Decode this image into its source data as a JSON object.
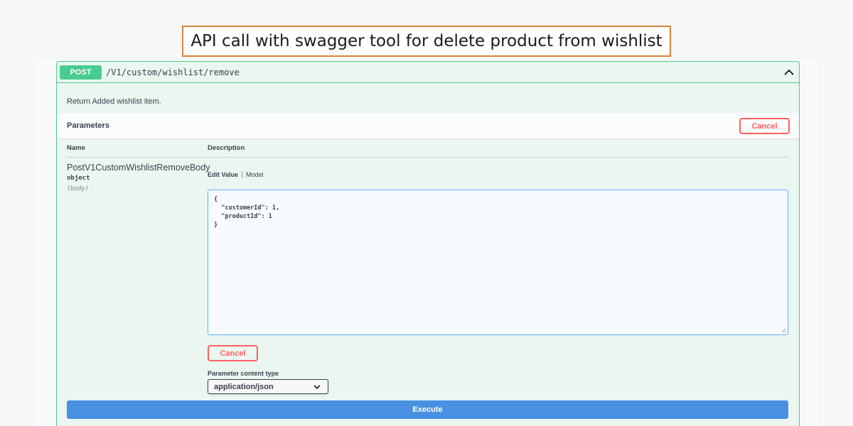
{
  "banner": {
    "title": "API call with swagger tool for delete product from wishlist"
  },
  "operation": {
    "method": "POST",
    "path": "/V1/custom/wishlist/remove",
    "description": "Return Added wishlist item."
  },
  "parameters": {
    "title": "Parameters",
    "cancel_label": "Cancel",
    "col_name": "Name",
    "col_description": "Description",
    "param": {
      "name": "PostV1CustomWishlistRemoveBody",
      "type": "object",
      "in": "(body)"
    },
    "tabs": {
      "edit_value": "Edit Value",
      "model": "Model"
    },
    "body_value": "{\n  \"customerId\": 1,\n  \"productId\": 1\n}",
    "bottom_cancel_label": "Cancel"
  },
  "content_type": {
    "label": "Parameter content type",
    "selected": "application/json"
  },
  "execute_label": "Execute",
  "colors": {
    "post_green": "#49cc90",
    "cancel_red": "#ff6060",
    "execute_blue": "#4990e2",
    "banner_border": "#d9823b"
  }
}
